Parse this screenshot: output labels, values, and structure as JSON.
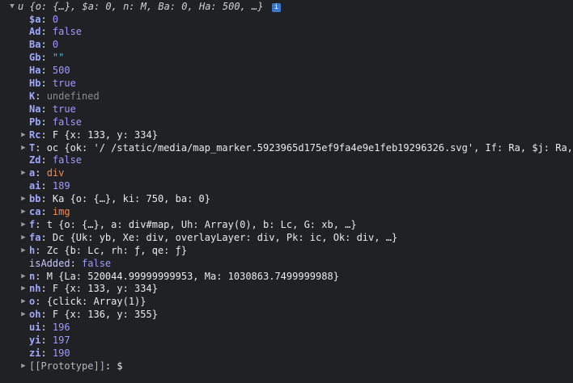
{
  "root": {
    "label": "u",
    "preview": "{o: {…}, $a: 0, n: M, Ba: 0, Ha: 500, …}",
    "badge": "i"
  },
  "rows": [
    {
      "key": "$a",
      "value": "0",
      "type": "num",
      "expandable": false
    },
    {
      "key": "Ad",
      "value": "false",
      "type": "bool",
      "expandable": false
    },
    {
      "key": "Ba",
      "value": "0",
      "type": "num",
      "expandable": false
    },
    {
      "key": "Gb",
      "value": "\"\"",
      "type": "str",
      "expandable": false
    },
    {
      "key": "Ha",
      "value": "500",
      "type": "num",
      "expandable": false
    },
    {
      "key": "Hb",
      "value": "true",
      "type": "bool",
      "expandable": false
    },
    {
      "key": "K",
      "value": "undefined",
      "type": "undef",
      "expandable": false
    },
    {
      "key": "Na",
      "value": "true",
      "type": "bool",
      "expandable": false
    },
    {
      "key": "Pb",
      "value": "false",
      "type": "bool",
      "expandable": false
    },
    {
      "key": "Rc",
      "value": "F {x: 133, y: 334}",
      "type": "obj",
      "expandable": true
    },
    {
      "key": "T",
      "value": "oc {ok: '/       /static/media/map_marker.5923965d175ef9fa4e9e1feb19296326.svg', If: Ra, $j: Ra, Qd: F, de:",
      "type": "obj",
      "expandable": true
    },
    {
      "key": "Zd",
      "value": "false",
      "type": "bool",
      "expandable": false
    },
    {
      "key": "a",
      "value": "div",
      "type": "tag",
      "expandable": true
    },
    {
      "key": "ai",
      "value": "189",
      "type": "num",
      "expandable": false
    },
    {
      "key": "bb",
      "value": "Ka {o: {…}, ki: 750, ba: 0}",
      "type": "obj",
      "expandable": true
    },
    {
      "key": "ca",
      "value": "img",
      "type": "tag",
      "expandable": true
    },
    {
      "key": "f",
      "value": "t {o: {…}, a: div#map, Uh: Array(0), b: Lc, G: xb, …}",
      "type": "obj",
      "expandable": true
    },
    {
      "key": "fa",
      "value": "Dc {Uk: yb, Xe: div, overlayLayer: div, Pk: ic, Ok: div, …}",
      "type": "obj",
      "expandable": true
    },
    {
      "key": "h",
      "value": "Zc {b: Lc, rh: ƒ, qe: ƒ}",
      "type": "obj",
      "expandable": true
    },
    {
      "key": "isAdded",
      "value": "false",
      "type": "bool",
      "expandable": false,
      "plain": true
    },
    {
      "key": "n",
      "value": "M {La: 520044.99999999953, Ma: 1030863.7499999988}",
      "type": "obj",
      "expandable": true
    },
    {
      "key": "nh",
      "value": "F {x: 133, y: 334}",
      "type": "obj",
      "expandable": true
    },
    {
      "key": "o",
      "value": "{click: Array(1)}",
      "type": "obj",
      "expandable": true
    },
    {
      "key": "oh",
      "value": "F {x: 136, y: 355}",
      "type": "obj",
      "expandable": true
    },
    {
      "key": "ui",
      "value": "196",
      "type": "num",
      "expandable": false
    },
    {
      "key": "yi",
      "value": "197",
      "type": "num",
      "expandable": false
    },
    {
      "key": "zi",
      "value": "190",
      "type": "num",
      "expandable": false
    }
  ],
  "prototype": {
    "key": "[[Prototype]]",
    "value": "$"
  }
}
